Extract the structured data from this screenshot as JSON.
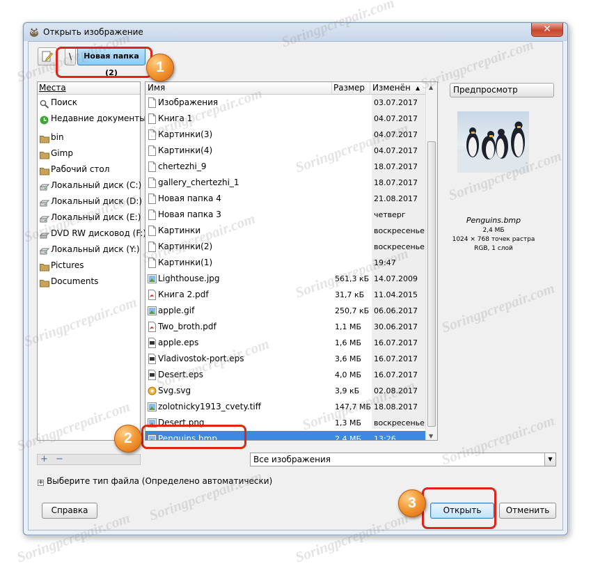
{
  "window": {
    "title": "Открыть изображение",
    "close_label": "✕"
  },
  "location": {
    "root_label": "\\",
    "current_folder": "Новая папка (2)"
  },
  "places": {
    "header": "Места",
    "items": [
      {
        "label": "Поиск",
        "icon": "search-icon"
      },
      {
        "label": "Недавние документы",
        "icon": "recent-icon"
      },
      {
        "label": "bin",
        "icon": "folder-icon"
      },
      {
        "label": "Gimp",
        "icon": "folder-icon"
      },
      {
        "label": "Рабочий стол",
        "icon": "folder-icon"
      },
      {
        "label": "Локальный диск (C:)",
        "icon": "drive-icon"
      },
      {
        "label": "Локальный диск (D:)",
        "icon": "drive-icon"
      },
      {
        "label": "Локальный диск (E:)",
        "icon": "drive-icon"
      },
      {
        "label": "DVD RW дисковод (F:)",
        "icon": "dvd-icon"
      },
      {
        "label": "Локальный диск (Y:)",
        "icon": "drive-icon"
      },
      {
        "label": "Pictures",
        "icon": "folder-icon"
      },
      {
        "label": "Documents",
        "icon": "folder-icon"
      }
    ],
    "add_label": "+",
    "remove_label": "−"
  },
  "files": {
    "columns": {
      "name": "Имя",
      "size": "Размер",
      "modified": "Изменён"
    },
    "rows": [
      {
        "name": "Изображения",
        "size": "",
        "modified": "03.07.2017",
        "icon": "folder"
      },
      {
        "name": "Книга 1",
        "size": "",
        "modified": "04.07.2017",
        "icon": "folder"
      },
      {
        "name": "Картинки(3)",
        "size": "",
        "modified": "04.07.2017",
        "icon": "folder"
      },
      {
        "name": "Картинки(4)",
        "size": "",
        "modified": "04.07.2017",
        "icon": "folder"
      },
      {
        "name": "chertezhi_9",
        "size": "",
        "modified": "18.07.2017",
        "icon": "folder"
      },
      {
        "name": "gallery_chertezhi_1",
        "size": "",
        "modified": "18.07.2017",
        "icon": "folder"
      },
      {
        "name": "Новая папка 4",
        "size": "",
        "modified": "21.08.2017",
        "icon": "folder"
      },
      {
        "name": "Новая папка 3",
        "size": "",
        "modified": "четверг",
        "icon": "folder"
      },
      {
        "name": "Картинки",
        "size": "",
        "modified": "воскресенье",
        "icon": "folder"
      },
      {
        "name": "Картинки(2)",
        "size": "",
        "modified": "воскресенье",
        "icon": "folder"
      },
      {
        "name": "Картинки(1)",
        "size": "",
        "modified": "19:47",
        "icon": "folder"
      },
      {
        "name": "Lighthouse.jpg",
        "size": "561,3 кБ",
        "modified": "14.07.2009",
        "icon": "image"
      },
      {
        "name": "Книга 2.pdf",
        "size": "31,7 кБ",
        "modified": "11.04.2015",
        "icon": "pdf"
      },
      {
        "name": "apple.gif",
        "size": "250,7 кБ",
        "modified": "06.06.2017",
        "icon": "image"
      },
      {
        "name": "Two_broth.pdf",
        "size": "1,1 МБ",
        "modified": "30.06.2017",
        "icon": "pdf"
      },
      {
        "name": "apple.eps",
        "size": "1,6 МБ",
        "modified": "16.07.2017",
        "icon": "eps"
      },
      {
        "name": "Vladivostok-port.eps",
        "size": "3,6 МБ",
        "modified": "16.07.2017",
        "icon": "eps"
      },
      {
        "name": "Desert.eps",
        "size": "4,0 МБ",
        "modified": "16.07.2017",
        "icon": "eps"
      },
      {
        "name": "Svg.svg",
        "size": "3,9 кБ",
        "modified": "02.08.2017",
        "icon": "svg"
      },
      {
        "name": "zolotnicky1913_cvety.tiff",
        "size": "147,7 МБ",
        "modified": "18.08.2017",
        "icon": "image"
      },
      {
        "name": "Desert.png",
        "size": "1,3 МБ",
        "modified": "воскресенье",
        "icon": "image"
      },
      {
        "name": "Penguins.bmp",
        "size": "2,4 МБ",
        "modified": "13:26",
        "icon": "image",
        "selected": true
      }
    ]
  },
  "preview": {
    "button_label": "Предпросмотр",
    "file_name": "Penguins.bmp",
    "size": "2,4 МБ",
    "dimensions": "1024 × 768 точек растра",
    "mode": "RGB, 1 слой"
  },
  "filter": {
    "selected": "Все изображения"
  },
  "file_type_label": "Выберите тип файла (Определено автоматически)",
  "buttons": {
    "help": "Справка",
    "open": "Открыть",
    "cancel": "Отменить"
  },
  "annotations": {
    "step1": "1",
    "step2": "2",
    "step3": "3",
    "color": "#e0241b"
  },
  "watermark": "Soringpcrepair.com"
}
